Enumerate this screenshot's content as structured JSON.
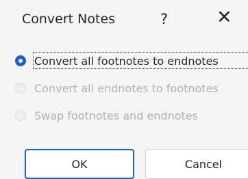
{
  "dialog": {
    "title": "Convert Notes",
    "help_label": "?",
    "close_label": "✕"
  },
  "options": [
    {
      "label": "Convert all footnotes to endnotes",
      "selected": true,
      "enabled": true
    },
    {
      "label": "Convert all endnotes to footnotes",
      "selected": false,
      "enabled": false
    },
    {
      "label": "Swap footnotes and endnotes",
      "selected": false,
      "enabled": false
    }
  ],
  "buttons": {
    "ok_label": "OK",
    "cancel_label": "Cancel"
  },
  "colors": {
    "accent": "#1a5fc7",
    "disabled_text": "#b0b0b0"
  }
}
